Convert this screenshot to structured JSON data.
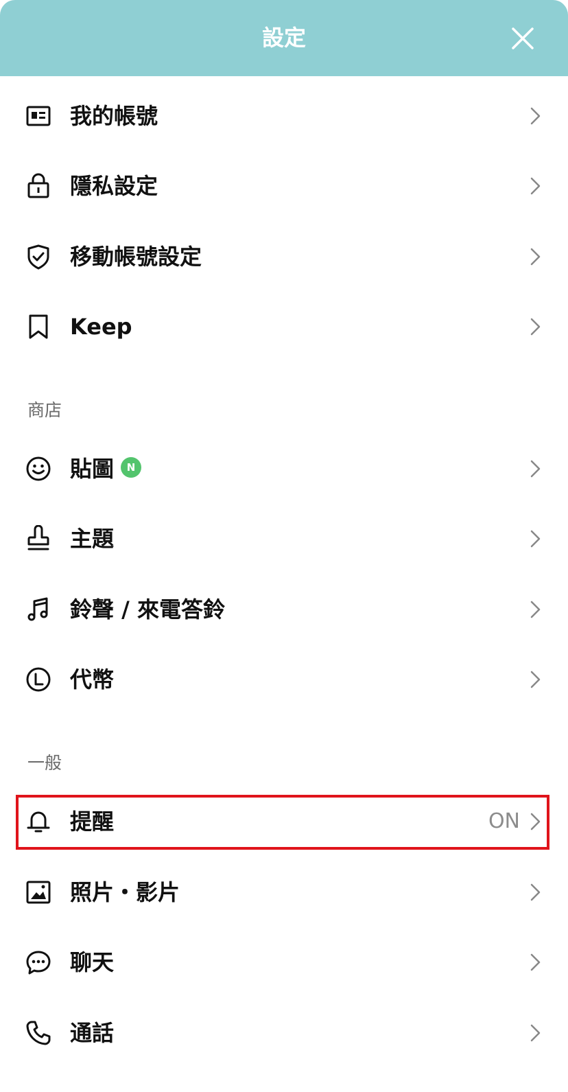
{
  "header": {
    "title": "設定",
    "close_icon": "close-icon"
  },
  "account_items": [
    {
      "label": "我的帳號",
      "icon": "id-card-icon"
    },
    {
      "label": "隱私設定",
      "icon": "lock-icon"
    },
    {
      "label": "移動帳號設定",
      "icon": "shield-check-icon"
    },
    {
      "label": "Keep",
      "icon": "bookmark-icon"
    }
  ],
  "store_section": {
    "title": "商店",
    "items": [
      {
        "label": "貼圖",
        "icon": "smiley-icon",
        "badge": "N"
      },
      {
        "label": "主題",
        "icon": "stamp-icon"
      },
      {
        "label": "鈴聲 / 來電答鈴",
        "icon": "music-note-icon"
      },
      {
        "label": "代幣",
        "icon": "coin-icon"
      }
    ]
  },
  "general_section": {
    "title": "一般",
    "items": [
      {
        "label": "提醒",
        "icon": "bell-icon",
        "value": "ON",
        "highlighted": true
      },
      {
        "label": "照片・影片",
        "icon": "photo-icon"
      },
      {
        "label": "聊天",
        "icon": "chat-bubble-icon"
      },
      {
        "label": "通話",
        "icon": "phone-icon"
      }
    ]
  },
  "colors": {
    "header_bg": "#8fcfd3",
    "badge_green": "#53c46d",
    "highlight_red": "#e0141b",
    "secondary_text": "#8c8c8c"
  }
}
